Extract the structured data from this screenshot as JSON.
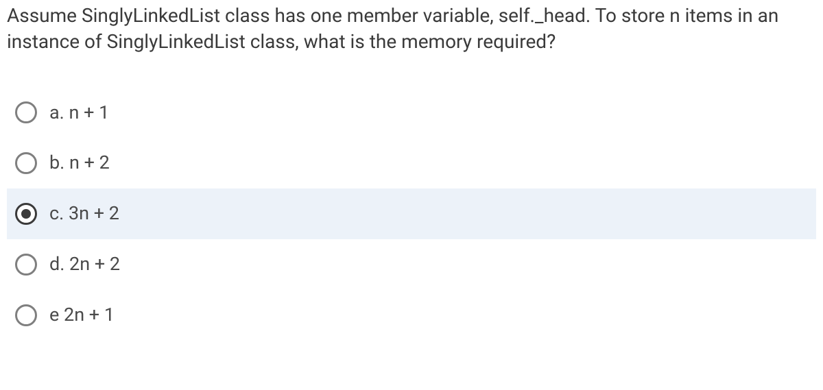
{
  "question": "Assume SinglyLinkedList class has one member variable, self._head. To store n items in an instance of SinglyLinkedList class, what is the memory required?",
  "options": {
    "a": "a. n + 1",
    "b": "b. n + 2",
    "c": "c. 3n + 2",
    "d": "d. 2n + 2",
    "e": "e 2n + 1"
  },
  "selected": "c"
}
